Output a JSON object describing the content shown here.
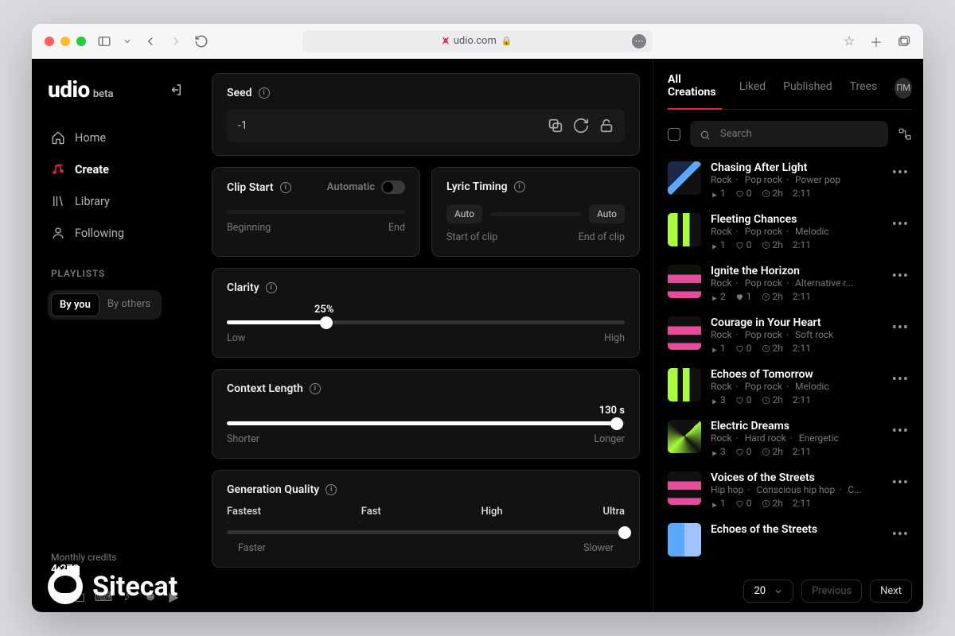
{
  "browser": {
    "url": "udio.com"
  },
  "brand": {
    "name": "udio",
    "suffix": "beta"
  },
  "nav": {
    "home": "Home",
    "create": "Create",
    "library": "Library",
    "following": "Following"
  },
  "playlists": {
    "label": "PLAYLISTS",
    "by_you": "By you",
    "by_others": "By others"
  },
  "credits": {
    "label": "Monthly credits",
    "value": "4,273"
  },
  "panels": {
    "seed": {
      "title": "Seed",
      "value": "-1"
    },
    "clip_start": {
      "title": "Clip Start",
      "automatic": "Automatic",
      "left": "Beginning",
      "right": "End"
    },
    "lyric": {
      "title": "Lyric Timing",
      "auto": "Auto",
      "left": "Start of clip",
      "right": "End of clip"
    },
    "clarity": {
      "title": "Clarity",
      "value": "25%",
      "percent": 25,
      "left": "Low",
      "right": "High"
    },
    "context": {
      "title": "Context Length",
      "value": "130 s",
      "percent": 98,
      "left": "Shorter",
      "right": "Longer"
    },
    "quality": {
      "title": "Generation Quality",
      "stops": {
        "fastest": "Fastest",
        "fast": "Fast",
        "high": "High",
        "ultra": "Ultra"
      },
      "left": "Faster",
      "right": "Slower",
      "percent": 100
    }
  },
  "tabs": {
    "all": "All Creations",
    "liked": "Liked",
    "published": "Published",
    "trees": "Trees"
  },
  "avatar": "ПМ",
  "search": {
    "placeholder": "Search"
  },
  "songs": [
    {
      "title": "Chasing After Light",
      "tags": "Rock   ·   Pop rock   ·   Power pop",
      "plays": "1",
      "likes": "0",
      "liked": false,
      "age": "2h",
      "dur": "2:11",
      "art": "blue"
    },
    {
      "title": "Fleeting Chances",
      "tags": "Rock   ·   Pop rock   ·   Melodic",
      "plays": "1",
      "likes": "0",
      "liked": false,
      "age": "2h",
      "dur": "2:11",
      "art": "green"
    },
    {
      "title": "Ignite the Horizon",
      "tags": "Rock   ·   Pop rock   ·   Alternative r...",
      "plays": "2",
      "likes": "1",
      "liked": true,
      "age": "2h",
      "dur": "2:11",
      "art": "magenta"
    },
    {
      "title": "Courage in Your Heart",
      "tags": "Rock   ·   Pop rock   ·   Soft rock",
      "plays": "1",
      "likes": "0",
      "liked": false,
      "age": "2h",
      "dur": "2:11",
      "art": "magenta"
    },
    {
      "title": "Echoes of Tomorrow",
      "tags": "Rock   ·   Pop rock   ·   Melodic",
      "plays": "3",
      "likes": "0",
      "liked": false,
      "age": "2h",
      "dur": "2:11",
      "art": "green"
    },
    {
      "title": "Electric Dreams",
      "tags": "Rock   ·   Hard rock   ·   Energetic",
      "plays": "3",
      "likes": "0",
      "liked": false,
      "age": "2h",
      "dur": "2:11",
      "art": "green2"
    },
    {
      "title": "Voices of the Streets",
      "tags": "Hip hop   ·   Conscious hip hop   ·   C...",
      "plays": "1",
      "likes": "0",
      "liked": false,
      "age": "2h",
      "dur": "2:11",
      "art": "magenta"
    },
    {
      "title": "Echoes of the Streets",
      "tags": "",
      "plays": "",
      "likes": "",
      "liked": false,
      "age": "",
      "dur": "",
      "art": "blue2"
    }
  ],
  "pager": {
    "page_size": "20",
    "prev": "Previous",
    "next": "Next"
  },
  "watermark": "Sitecat"
}
